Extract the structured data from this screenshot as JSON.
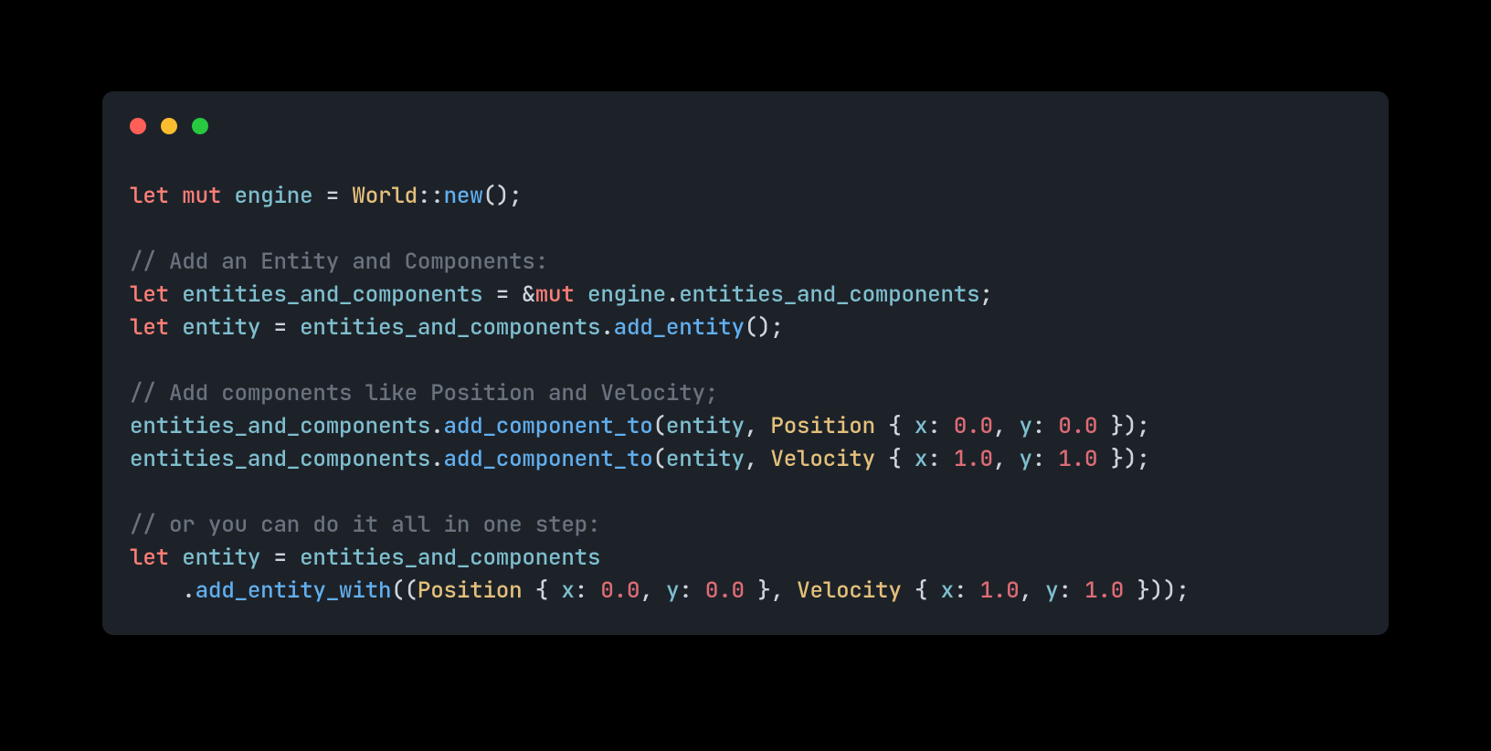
{
  "colors": {
    "background": "#000000",
    "panel": "#1d2229",
    "keyword": "#ff7f77",
    "variable": "#7fbfcf",
    "type": "#e5c07b",
    "method": "#61afef",
    "number": "#e06c75",
    "comment": "#6a737d",
    "foreground": "#cdd4db",
    "window_red": "#ff5f57",
    "window_yellow": "#febc2e",
    "window_green": "#28c840"
  },
  "traffic_lights": [
    "close",
    "minimize",
    "maximize"
  ],
  "code": {
    "lines": [
      [
        {
          "t": "let ",
          "cls": "c-kw"
        },
        {
          "t": "mut ",
          "cls": "c-kw"
        },
        {
          "t": "engine",
          "cls": "c-var"
        },
        {
          "t": " = ",
          "cls": "c-punc"
        },
        {
          "t": "World",
          "cls": "c-type"
        },
        {
          "t": "::",
          "cls": "c-punc"
        },
        {
          "t": "new",
          "cls": "c-method"
        },
        {
          "t": "();",
          "cls": "c-punc"
        }
      ],
      [],
      [
        {
          "t": "// Add an Entity and Components:",
          "cls": "c-comment"
        }
      ],
      [
        {
          "t": "let ",
          "cls": "c-kw"
        },
        {
          "t": "entities_and_components",
          "cls": "c-var"
        },
        {
          "t": " = &",
          "cls": "c-punc"
        },
        {
          "t": "mut ",
          "cls": "c-kw"
        },
        {
          "t": "engine",
          "cls": "c-var"
        },
        {
          "t": ".",
          "cls": "c-punc"
        },
        {
          "t": "entities_and_components",
          "cls": "c-var"
        },
        {
          "t": ";",
          "cls": "c-punc"
        }
      ],
      [
        {
          "t": "let ",
          "cls": "c-kw"
        },
        {
          "t": "entity",
          "cls": "c-var"
        },
        {
          "t": " = ",
          "cls": "c-punc"
        },
        {
          "t": "entities_and_components",
          "cls": "c-var"
        },
        {
          "t": ".",
          "cls": "c-punc"
        },
        {
          "t": "add_entity",
          "cls": "c-method"
        },
        {
          "t": "();",
          "cls": "c-punc"
        }
      ],
      [],
      [
        {
          "t": "// Add components like Position and Velocity;",
          "cls": "c-comment"
        }
      ],
      [
        {
          "t": "entities_and_components",
          "cls": "c-var"
        },
        {
          "t": ".",
          "cls": "c-punc"
        },
        {
          "t": "add_component_to",
          "cls": "c-method"
        },
        {
          "t": "(",
          "cls": "c-punc"
        },
        {
          "t": "entity",
          "cls": "c-var"
        },
        {
          "t": ", ",
          "cls": "c-punc"
        },
        {
          "t": "Position",
          "cls": "c-type"
        },
        {
          "t": " { ",
          "cls": "c-punc"
        },
        {
          "t": "x",
          "cls": "c-var"
        },
        {
          "t": ": ",
          "cls": "c-punc"
        },
        {
          "t": "0.0",
          "cls": "c-num"
        },
        {
          "t": ", ",
          "cls": "c-punc"
        },
        {
          "t": "y",
          "cls": "c-var"
        },
        {
          "t": ": ",
          "cls": "c-punc"
        },
        {
          "t": "0.0",
          "cls": "c-num"
        },
        {
          "t": " });",
          "cls": "c-punc"
        }
      ],
      [
        {
          "t": "entities_and_components",
          "cls": "c-var"
        },
        {
          "t": ".",
          "cls": "c-punc"
        },
        {
          "t": "add_component_to",
          "cls": "c-method"
        },
        {
          "t": "(",
          "cls": "c-punc"
        },
        {
          "t": "entity",
          "cls": "c-var"
        },
        {
          "t": ", ",
          "cls": "c-punc"
        },
        {
          "t": "Velocity",
          "cls": "c-type"
        },
        {
          "t": " { ",
          "cls": "c-punc"
        },
        {
          "t": "x",
          "cls": "c-var"
        },
        {
          "t": ": ",
          "cls": "c-punc"
        },
        {
          "t": "1.0",
          "cls": "c-num"
        },
        {
          "t": ", ",
          "cls": "c-punc"
        },
        {
          "t": "y",
          "cls": "c-var"
        },
        {
          "t": ": ",
          "cls": "c-punc"
        },
        {
          "t": "1.0",
          "cls": "c-num"
        },
        {
          "t": " });",
          "cls": "c-punc"
        }
      ],
      [],
      [
        {
          "t": "// or you can do it all in one step:",
          "cls": "c-comment"
        }
      ],
      [
        {
          "t": "let ",
          "cls": "c-kw"
        },
        {
          "t": "entity",
          "cls": "c-var"
        },
        {
          "t": " = ",
          "cls": "c-punc"
        },
        {
          "t": "entities_and_components",
          "cls": "c-var"
        }
      ],
      [
        {
          "t": "    .",
          "cls": "c-punc"
        },
        {
          "t": "add_entity_with",
          "cls": "c-method"
        },
        {
          "t": "((",
          "cls": "c-punc"
        },
        {
          "t": "Position",
          "cls": "c-type"
        },
        {
          "t": " { ",
          "cls": "c-punc"
        },
        {
          "t": "x",
          "cls": "c-var"
        },
        {
          "t": ": ",
          "cls": "c-punc"
        },
        {
          "t": "0.0",
          "cls": "c-num"
        },
        {
          "t": ", ",
          "cls": "c-punc"
        },
        {
          "t": "y",
          "cls": "c-var"
        },
        {
          "t": ": ",
          "cls": "c-punc"
        },
        {
          "t": "0.0",
          "cls": "c-num"
        },
        {
          "t": " }, ",
          "cls": "c-punc"
        },
        {
          "t": "Velocity",
          "cls": "c-type"
        },
        {
          "t": " { ",
          "cls": "c-punc"
        },
        {
          "t": "x",
          "cls": "c-var"
        },
        {
          "t": ": ",
          "cls": "c-punc"
        },
        {
          "t": "1.0",
          "cls": "c-num"
        },
        {
          "t": ", ",
          "cls": "c-punc"
        },
        {
          "t": "y",
          "cls": "c-var"
        },
        {
          "t": ": ",
          "cls": "c-punc"
        },
        {
          "t": "1.0",
          "cls": "c-num"
        },
        {
          "t": " }));",
          "cls": "c-punc"
        }
      ]
    ]
  }
}
